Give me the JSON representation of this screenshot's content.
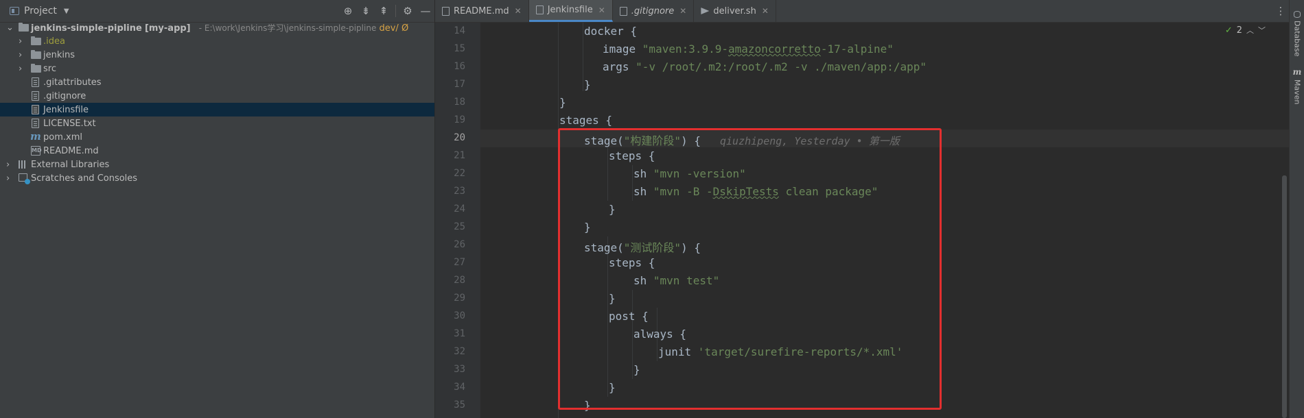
{
  "project_panel": {
    "title": "Project",
    "toolbar_icons": [
      "locate-icon",
      "expand-all-icon",
      "collapse-all-icon",
      "gear-icon",
      "minimize-icon"
    ],
    "tree": [
      {
        "label": "jenkins-simple-pipline",
        "module": "[my-app]",
        "path": "- E:\\work\\Jenkins学习\\jenkins-simple-pipline",
        "branch": "dev/ Ø",
        "icon": "module-folder-icon"
      },
      {
        "label": ".idea",
        "icon": "folder-icon"
      },
      {
        "label": "jenkins",
        "icon": "folder-icon"
      },
      {
        "label": "src",
        "icon": "folder-icon"
      },
      {
        "label": ".gitattributes",
        "icon": "file-icon"
      },
      {
        "label": ".gitignore",
        "icon": "gitignore-file-icon"
      },
      {
        "label": "Jenkinsfile",
        "icon": "file-icon"
      },
      {
        "label": "LICENSE.txt",
        "icon": "text-file-icon"
      },
      {
        "label": "pom.xml",
        "icon": "maven-icon"
      },
      {
        "label": "README.md",
        "icon": "markdown-file-icon"
      },
      {
        "label": "External Libraries",
        "icon": "libraries-icon"
      },
      {
        "label": "Scratches and Consoles",
        "icon": "scratches-icon"
      }
    ]
  },
  "tabs": [
    {
      "label": "README.md",
      "icon": "markdown-file-icon",
      "italic": false
    },
    {
      "label": "Jenkinsfile",
      "icon": "file-icon",
      "italic": false,
      "active": true
    },
    {
      "label": ".gitignore",
      "icon": "gitignore-file-icon",
      "italic": true
    },
    {
      "label": "deliver.sh",
      "icon": "shell-file-icon",
      "italic": false
    }
  ],
  "editor": {
    "current_line": "20",
    "inspection_count": "2",
    "lines": [
      {
        "n": "14"
      },
      {
        "n": "15"
      },
      {
        "n": "16"
      },
      {
        "n": "17"
      },
      {
        "n": "18"
      },
      {
        "n": "19"
      },
      {
        "n": "20"
      },
      {
        "n": "21"
      },
      {
        "n": "22"
      },
      {
        "n": "23"
      },
      {
        "n": "24"
      },
      {
        "n": "25"
      },
      {
        "n": "26"
      },
      {
        "n": "27"
      },
      {
        "n": "28"
      },
      {
        "n": "29"
      },
      {
        "n": "30"
      },
      {
        "n": "31"
      },
      {
        "n": "32"
      },
      {
        "n": "33"
      },
      {
        "n": "34"
      },
      {
        "n": "35"
      }
    ],
    "code": {
      "l14": "docker {",
      "l15_kw": "image ",
      "l15_s1": "\"maven:3.9.9-",
      "l15_s2": "amazoncorretto",
      "l15_s3": "-17-alpine\"",
      "l16_kw": "args ",
      "l16_s": "\"-v /root/.m2:/root/.m2 -v ./maven/app:/app\"",
      "l17": "}",
      "l18": "}",
      "l19": "stages {",
      "l20_a": "stage(",
      "l20_s": "\"构建阶段\"",
      "l20_b": ") {",
      "l20_blame": "qiuzhipeng, Yesterday • 第一版",
      "l21": "steps {",
      "l22_kw": "sh ",
      "l22_s": "\"mvn -version\"",
      "l23_kw": "sh ",
      "l23_s1": "\"mvn -B -",
      "l23_s2": "DskipTests",
      "l23_s3": " clean package\"",
      "l24": "}",
      "l25": "}",
      "l26_a": "stage(",
      "l26_s": "\"测试阶段\"",
      "l26_b": ") {",
      "l27": "steps {",
      "l28_kw": "sh ",
      "l28_s": "\"mvn test\"",
      "l29": "}",
      "l30": "post {",
      "l31": "always {",
      "l32_kw": "junit ",
      "l32_s": "'target/surefire-reports/*.xml'",
      "l33": "}",
      "l34": "}",
      "l35": "}"
    }
  },
  "right_strip": [
    "Database",
    "Maven"
  ],
  "colors": {
    "highlight_box": "#e32f2f",
    "string": "#6a8759",
    "selection": "#0d293e"
  }
}
